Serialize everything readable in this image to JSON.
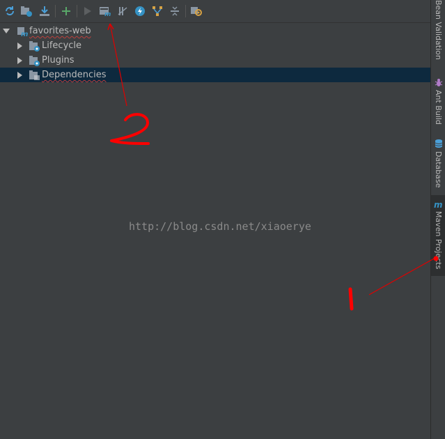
{
  "toolbar": {
    "buttons": [
      {
        "name": "reimport-icon"
      },
      {
        "name": "generate-sources-icon"
      },
      {
        "name": "download-sources-icon"
      },
      {
        "name": "add-icon"
      },
      {
        "name": "run-icon"
      },
      {
        "name": "execute-maven-goal-icon"
      },
      {
        "name": "toggle-offline-icon"
      },
      {
        "name": "skip-tests-icon"
      },
      {
        "name": "show-dependencies-icon"
      },
      {
        "name": "collapse-all-icon"
      },
      {
        "name": "settings-icon"
      }
    ]
  },
  "tree": {
    "root": {
      "label": "favorites-web"
    },
    "children": [
      {
        "label": "Lifecycle"
      },
      {
        "label": "Plugins"
      },
      {
        "label": "Dependencies"
      }
    ]
  },
  "sidebar": {
    "tabs": [
      {
        "label": "Bean Validation"
      },
      {
        "label": "Ant Build"
      },
      {
        "label": "Database"
      },
      {
        "label": "Maven Projects"
      }
    ]
  },
  "watermark": "http://blog.csdn.net/xiaoerye",
  "colors": {
    "background": "#3c3f41",
    "selection": "#0d293e",
    "annotation_red": "#ff0000",
    "maven_icon": "#3592c4"
  }
}
